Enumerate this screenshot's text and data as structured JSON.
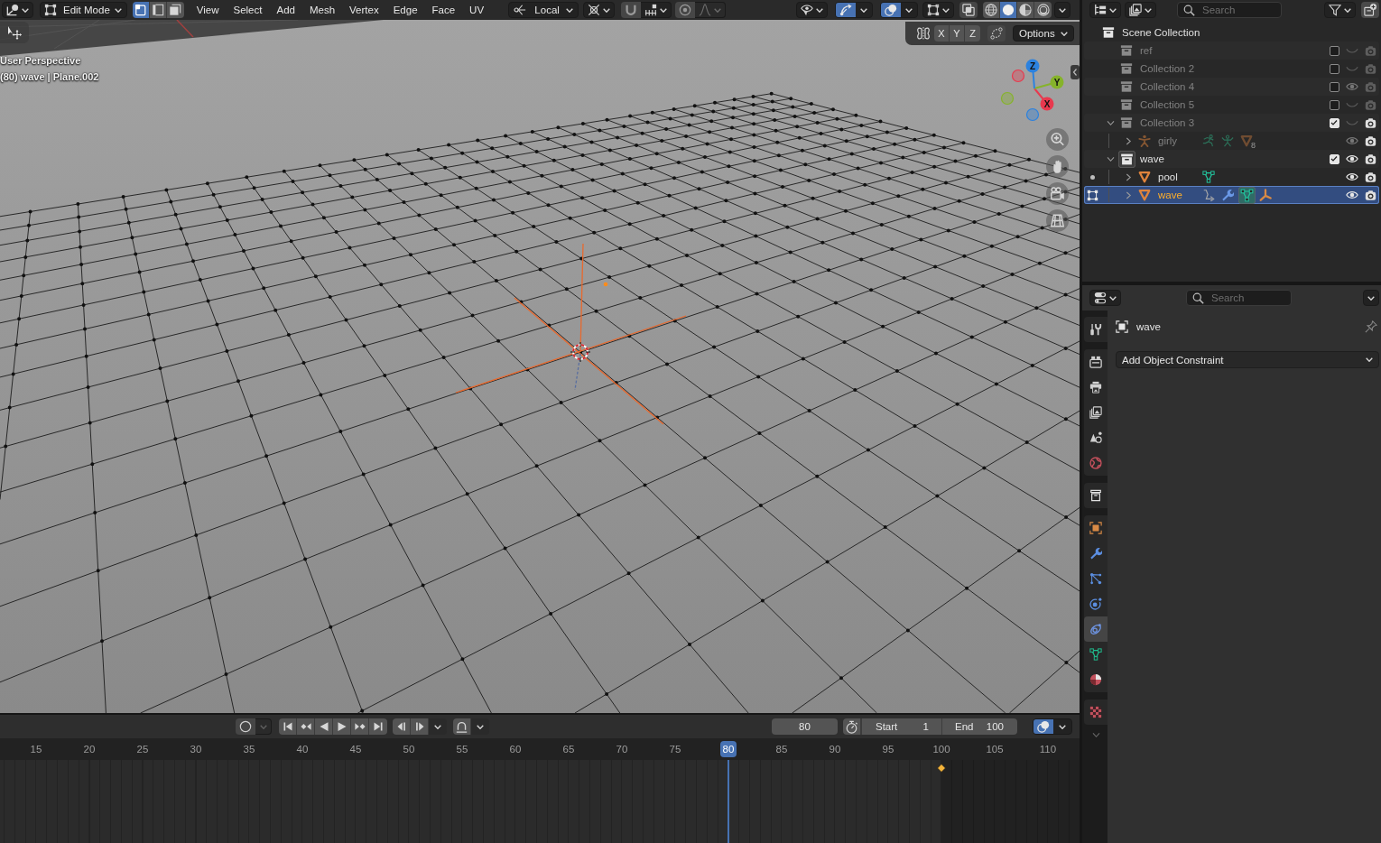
{
  "viewport": {
    "header": {
      "mode": "Edit Mode",
      "select_modes": [
        {
          "kind": "vertex",
          "selected": true
        },
        {
          "kind": "edge",
          "selected": false
        },
        {
          "kind": "face",
          "selected": false
        }
      ],
      "menus": [
        "View",
        "Select",
        "Add",
        "Mesh",
        "Vertex",
        "Edge",
        "Face",
        "UV"
      ],
      "orientation": "Local",
      "snap_on": false,
      "proportional_on": false,
      "gizmos_on": true,
      "overlays_on": true,
      "xray_on": false,
      "shading": [
        {
          "kind": "wireframe",
          "selected": false
        },
        {
          "kind": "solid",
          "selected": true
        },
        {
          "kind": "material",
          "selected": false
        },
        {
          "kind": "rendered",
          "selected": false
        }
      ]
    },
    "mirror_axes": [
      {
        "label": "X",
        "on": false
      },
      {
        "label": "Y",
        "on": false
      },
      {
        "label": "Z",
        "on": false
      }
    ],
    "options_label": "Options",
    "overlay_text": [
      "User Perspective",
      "(80) wave | Plane.002"
    ],
    "axes": [
      {
        "label": "X",
        "color": "#e8394e"
      },
      {
        "label": "Y",
        "color": "#86b32b"
      },
      {
        "label": "Z",
        "color": "#2c82df"
      }
    ]
  },
  "outliner": {
    "search_placeholder": "Search",
    "tree": [
      {
        "label": "Scene Collection",
        "kind": "scene_collection",
        "selected": false,
        "children": [
          {
            "label": "ref",
            "kind": "collection",
            "selected": false,
            "active": false,
            "dimmed": true,
            "checked": false,
            "visible": false
          },
          {
            "label": "Collection 2",
            "kind": "collection",
            "selected": false,
            "active": false,
            "dimmed": true,
            "checked": false,
            "visible": false
          },
          {
            "label": "Collection 4",
            "kind": "collection",
            "selected": false,
            "active": false,
            "dimmed": true,
            "checked": false,
            "visible": true
          },
          {
            "label": "Collection 5",
            "kind": "collection",
            "selected": false,
            "active": false,
            "dimmed": true,
            "checked": false,
            "visible": false
          },
          {
            "label": "Collection 3",
            "kind": "collection",
            "selected": false,
            "active": false,
            "dimmed": true,
            "checked": true,
            "visible": false,
            "expanded": true,
            "children": [
              {
                "label": "girly",
                "kind": "armature",
                "selected": false,
                "dimmed": true,
                "visible": true,
                "expanded": false,
                "data": [
                  {
                    "kind": "pose",
                    "active": false
                  },
                  {
                    "kind": "armature_data",
                    "active": false
                  },
                  {
                    "kind": "mesh_objects",
                    "active": false,
                    "count": "8"
                  }
                ]
              }
            ]
          },
          {
            "label": "wave",
            "kind": "collection",
            "selected": false,
            "active": true,
            "dimmed": false,
            "checked": true,
            "visible": true,
            "expanded": true,
            "children": [
              {
                "label": "pool",
                "kind": "mesh",
                "selected": false,
                "dimmed": false,
                "visible": true,
                "expanded": false,
                "edit_mode": false,
                "data": [
                  {
                    "kind": "mesh_data",
                    "active": false
                  }
                ]
              },
              {
                "label": "wave",
                "kind": "mesh",
                "selected": true,
                "dimmed": false,
                "visible": true,
                "expanded": false,
                "edit_mode": true,
                "data": [
                  {
                    "kind": "action",
                    "active": false
                  },
                  {
                    "kind": "modifier",
                    "active": false
                  },
                  {
                    "kind": "mesh_data",
                    "active": true
                  },
                  {
                    "kind": "vertex_groups",
                    "active": false
                  }
                ]
              }
            ]
          }
        ]
      }
    ]
  },
  "properties": {
    "search_placeholder": "Search",
    "tab_groups": [
      {
        "tabs": [
          {
            "kind": "tool",
            "selected": false
          }
        ]
      },
      {
        "tabs": [
          {
            "kind": "render",
            "selected": false
          },
          {
            "kind": "output",
            "selected": false
          },
          {
            "kind": "view_layer",
            "selected": false
          },
          {
            "kind": "scene",
            "selected": false
          },
          {
            "kind": "world",
            "selected": false
          }
        ]
      },
      {
        "tabs": [
          {
            "kind": "collection",
            "selected": false
          }
        ]
      },
      {
        "tabs": [
          {
            "kind": "object",
            "selected": false
          },
          {
            "kind": "modifiers",
            "selected": false
          },
          {
            "kind": "particles",
            "selected": false
          },
          {
            "kind": "physics",
            "selected": false
          },
          {
            "kind": "constraints",
            "selected": true
          },
          {
            "kind": "data",
            "selected": false
          },
          {
            "kind": "material",
            "selected": false
          }
        ]
      },
      {
        "tabs": [
          {
            "kind": "texture",
            "selected": false
          }
        ]
      }
    ],
    "object_name": "wave",
    "add_button": "Add Object Constraint"
  },
  "timeline": {
    "auto_key_on": false,
    "current_frame": "80",
    "preview_range_on": false,
    "start": {
      "label": "Start",
      "value": "1"
    },
    "end": {
      "label": "End",
      "value": "100"
    },
    "view_toggle_on": true,
    "ticks": [
      {
        "label": "15",
        "current": false,
        "keyframe": false,
        "range_end": false
      },
      {
        "label": "20",
        "current": false,
        "keyframe": false,
        "range_end": false
      },
      {
        "label": "25",
        "current": false,
        "keyframe": false,
        "range_end": false
      },
      {
        "label": "30",
        "current": false,
        "keyframe": false,
        "range_end": false
      },
      {
        "label": "35",
        "current": false,
        "keyframe": false,
        "range_end": false
      },
      {
        "label": "40",
        "current": false,
        "keyframe": false,
        "range_end": false
      },
      {
        "label": "45",
        "current": false,
        "keyframe": false,
        "range_end": false
      },
      {
        "label": "50",
        "current": false,
        "keyframe": false,
        "range_end": false
      },
      {
        "label": "55",
        "current": false,
        "keyframe": false,
        "range_end": false
      },
      {
        "label": "60",
        "current": false,
        "keyframe": false,
        "range_end": false
      },
      {
        "label": "65",
        "current": false,
        "keyframe": false,
        "range_end": false
      },
      {
        "label": "70",
        "current": false,
        "keyframe": false,
        "range_end": false
      },
      {
        "label": "75",
        "current": false,
        "keyframe": false,
        "range_end": false
      },
      {
        "label": "80",
        "current": true,
        "keyframe": false,
        "range_end": false
      },
      {
        "label": "85",
        "current": false,
        "keyframe": false,
        "range_end": false
      },
      {
        "label": "90",
        "current": false,
        "keyframe": false,
        "range_end": false
      },
      {
        "label": "95",
        "current": false,
        "keyframe": false,
        "range_end": false
      },
      {
        "label": "100",
        "current": false,
        "keyframe": true,
        "range_end": true
      },
      {
        "label": "105",
        "current": false,
        "keyframe": false,
        "range_end": false
      },
      {
        "label": "110",
        "current": false,
        "keyframe": false,
        "range_end": false
      }
    ]
  }
}
